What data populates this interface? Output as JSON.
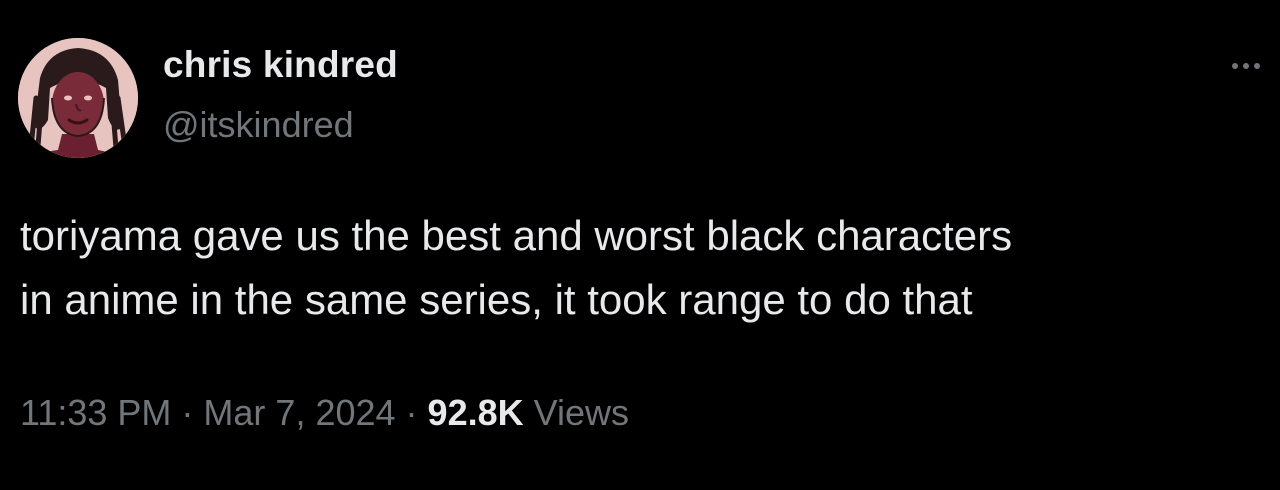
{
  "author": {
    "display_name": "chris kindred",
    "handle": "@itskindred",
    "avatar_icon": "illustrated-portrait-avatar"
  },
  "tweet": {
    "lines": [
      "toriyama gave us the best and worst black characters",
      "in anime in the same series, it took range to do that"
    ],
    "time": "11:33 PM",
    "date": "Mar 7, 2024",
    "separator": "·",
    "views_count": "92.8K",
    "views_label": "Views"
  },
  "more_icon": "more-horizontal-icon",
  "colors": {
    "background": "#000000",
    "primary_text": "#e7e9ea",
    "secondary_text": "#71767b",
    "avatar_bg": "#e8c4c0",
    "avatar_figure": "#7a2b3a"
  }
}
